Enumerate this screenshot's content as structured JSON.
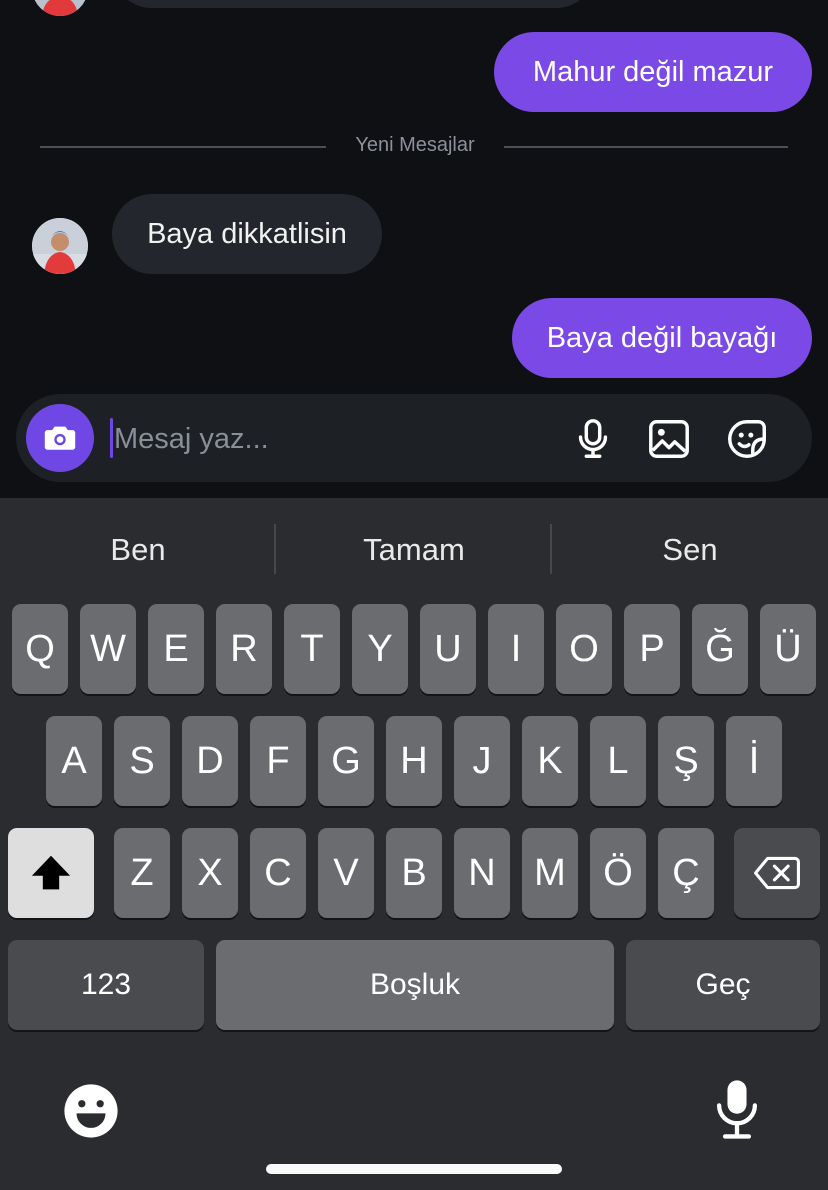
{
  "chat": {
    "messages": [
      {
        "side": "out",
        "text": "Mahur değil mazur"
      },
      {
        "side": "in",
        "text": "Baya dikkatlisin"
      },
      {
        "side": "out",
        "text": "Baya değil bayağı"
      }
    ],
    "new_messages_divider": "Yeni Mesajlar"
  },
  "composer": {
    "placeholder": "Mesaj yaz...",
    "camera_icon": "camera-icon",
    "mic_icon": "microphone-icon",
    "image_icon": "image-icon",
    "sticker_icon": "sticker-icon",
    "accent_color": "#6f47e5"
  },
  "keyboard": {
    "suggestions": [
      "Ben",
      "Tamam",
      "Sen"
    ],
    "row1": [
      "Q",
      "W",
      "E",
      "R",
      "T",
      "Y",
      "U",
      "I",
      "O",
      "P",
      "Ğ",
      "Ü"
    ],
    "row2": [
      "A",
      "S",
      "D",
      "F",
      "G",
      "H",
      "J",
      "K",
      "L",
      "Ş",
      "İ"
    ],
    "row3": [
      "Z",
      "X",
      "C",
      "V",
      "B",
      "N",
      "M",
      "Ö",
      "Ç"
    ],
    "numbers_key": "123",
    "space_key": "Boşluk",
    "return_key": "Geç",
    "shift_icon": "shift-icon",
    "backspace_icon": "backspace-icon",
    "emoji_icon": "emoji-icon",
    "dictation_icon": "microphone-icon"
  }
}
